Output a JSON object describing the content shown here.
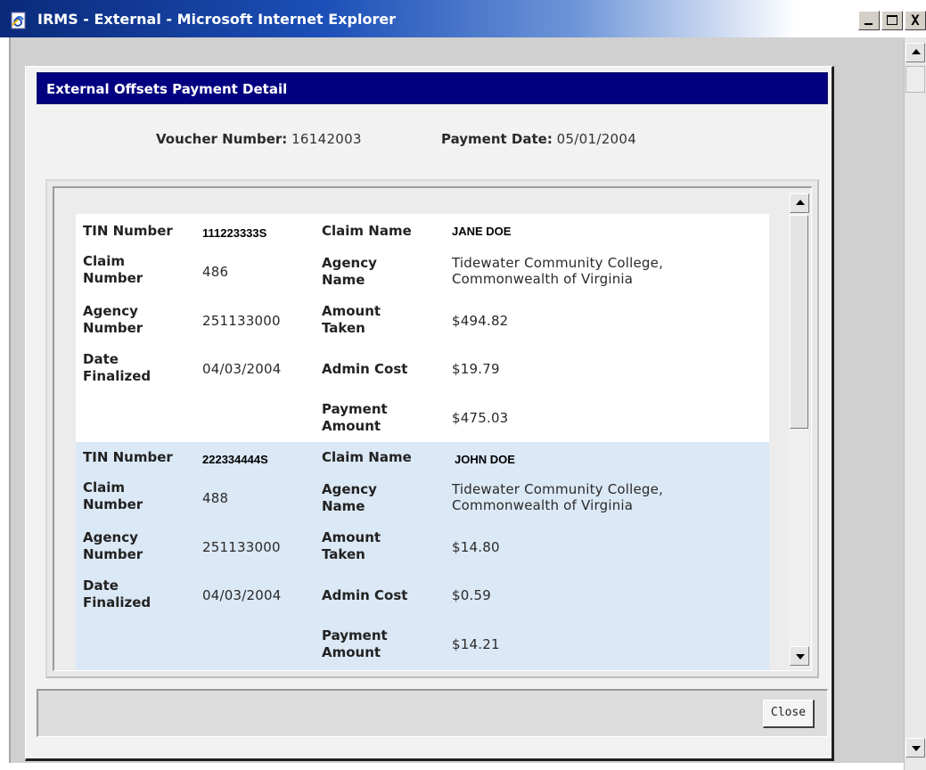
{
  "window": {
    "title": "IRMS - External - Microsoft Internet Explorer",
    "controls": {
      "minimize": "_",
      "maximize": "□",
      "close": "X"
    }
  },
  "dialog": {
    "title": "External Offsets Payment Detail",
    "voucher_label": "Voucher Number:",
    "voucher_value": "16142003",
    "payment_date_label": "Payment Date:",
    "payment_date_value": "05/01/2004",
    "labels": {
      "tin": "TIN Number",
      "claim_number_1": "Claim",
      "claim_number_2": "Number",
      "agency_number_1": "Agency",
      "agency_number_2": "Number",
      "date_finalized_1": "Date",
      "date_finalized_2": "Finalized",
      "claim_name": "Claim Name",
      "agency_name_1": "Agency",
      "agency_name_2": "Name",
      "amount_taken_1": "Amount",
      "amount_taken_2": "Taken",
      "admin_cost": "Admin Cost",
      "payment_amount_1": "Payment",
      "payment_amount_2": "Amount"
    },
    "records": [
      {
        "tin": "111223333S",
        "claim_number": "486",
        "agency_number": "251133000",
        "date_finalized": "04/03/2004",
        "claim_name": "JANE DOE",
        "agency_name_line1": "Tidewater Community College,",
        "agency_name_line2": "Commonwealth of Virginia",
        "amount_taken": "$494.82",
        "admin_cost": "$19.79",
        "payment_amount": "$475.03"
      },
      {
        "tin": "222334444S",
        "claim_number": "488",
        "agency_number": "251133000",
        "date_finalized": "04/03/2004",
        "claim_name": "JOHN DOE",
        "agency_name_line1": "Tidewater Community College,",
        "agency_name_line2": "Commonwealth of Virginia",
        "amount_taken": "$14.80",
        "admin_cost": "$0.59",
        "payment_amount": "$14.21"
      }
    ],
    "close_label": "Close"
  },
  "colors": {
    "header_bg": "#000080",
    "row_alt_bg": "#dbe8f5"
  },
  "icons": {
    "window_icon": "ie-page-icon",
    "scroll_up": "scroll-up-arrow-icon",
    "scroll_down": "scroll-down-arrow-icon"
  }
}
